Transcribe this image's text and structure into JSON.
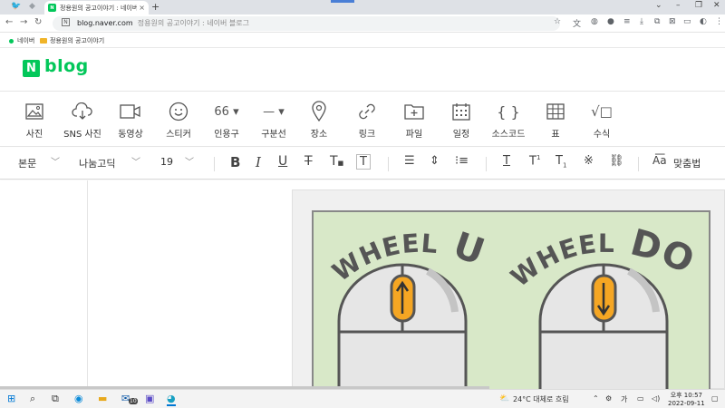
{
  "browser": {
    "tab_active_title": "정용원의 공고이야기 : 네이버 ...",
    "tab_favicon": "N",
    "tab_close": "×",
    "new_tab": "+",
    "url_domain": "blog.naver.com",
    "url_page_title": "정용원의 공고이야기 : 네이버 블로그",
    "bookmarks": [
      {
        "label": "네이버",
        "icon": "naver-dot-icon"
      },
      {
        "label": "정용원의 공고이야기",
        "icon": "folder-icon"
      }
    ]
  },
  "blog": {
    "logo_n": "N",
    "logo_text": "blog"
  },
  "insert_toolbar": [
    {
      "label": "사진",
      "icon": "image-icon"
    },
    {
      "label": "SNS 사진",
      "icon": "cloud-download-icon"
    },
    {
      "label": "동영상",
      "icon": "video-icon"
    },
    {
      "label": "스티커",
      "icon": "smiley-icon"
    },
    {
      "label": "인용구",
      "icon": "quote-icon",
      "glyph": "66 ▾"
    },
    {
      "label": "구분선",
      "icon": "divider-icon",
      "glyph": "— ▾"
    },
    {
      "label": "장소",
      "icon": "location-pin-icon"
    },
    {
      "label": "링크",
      "icon": "link-icon"
    },
    {
      "label": "파일",
      "icon": "folder-plus-icon"
    },
    {
      "label": "일정",
      "icon": "calendar-icon"
    },
    {
      "label": "소스코드",
      "icon": "code-braces-icon",
      "glyph": "{ }"
    },
    {
      "label": "표",
      "icon": "table-icon"
    },
    {
      "label": "수식",
      "icon": "formula-icon",
      "glyph": "√□"
    }
  ],
  "format_toolbar": {
    "paragraph_style": "본문",
    "font_family": "나눔고딕",
    "font_size": "19",
    "spellcheck": "맞춤법",
    "buttons": [
      "bold-icon",
      "italic-icon",
      "underline-icon",
      "strikethrough-icon",
      "text-color-icon",
      "text-background-icon",
      "align-left-icon",
      "line-height-icon",
      "list-icon",
      "text-style-icon",
      "superscript-icon",
      "subscript-icon",
      "special-char-icon",
      "link-icon"
    ]
  },
  "artwork": {
    "left_title_1": "WHEEL",
    "left_title_2": "UP",
    "right_title_1": "WHEEL",
    "right_title_2": "DOWN",
    "colors": {
      "background": "#d8e8c8",
      "wheel": "#f5a623",
      "mouse": "#e4e4e4",
      "outline": "#555555"
    }
  },
  "taskbar": {
    "weather": "24°C  대체로 흐림",
    "time": "오후 10:57",
    "date": "2022-09-11",
    "badge": "10"
  }
}
